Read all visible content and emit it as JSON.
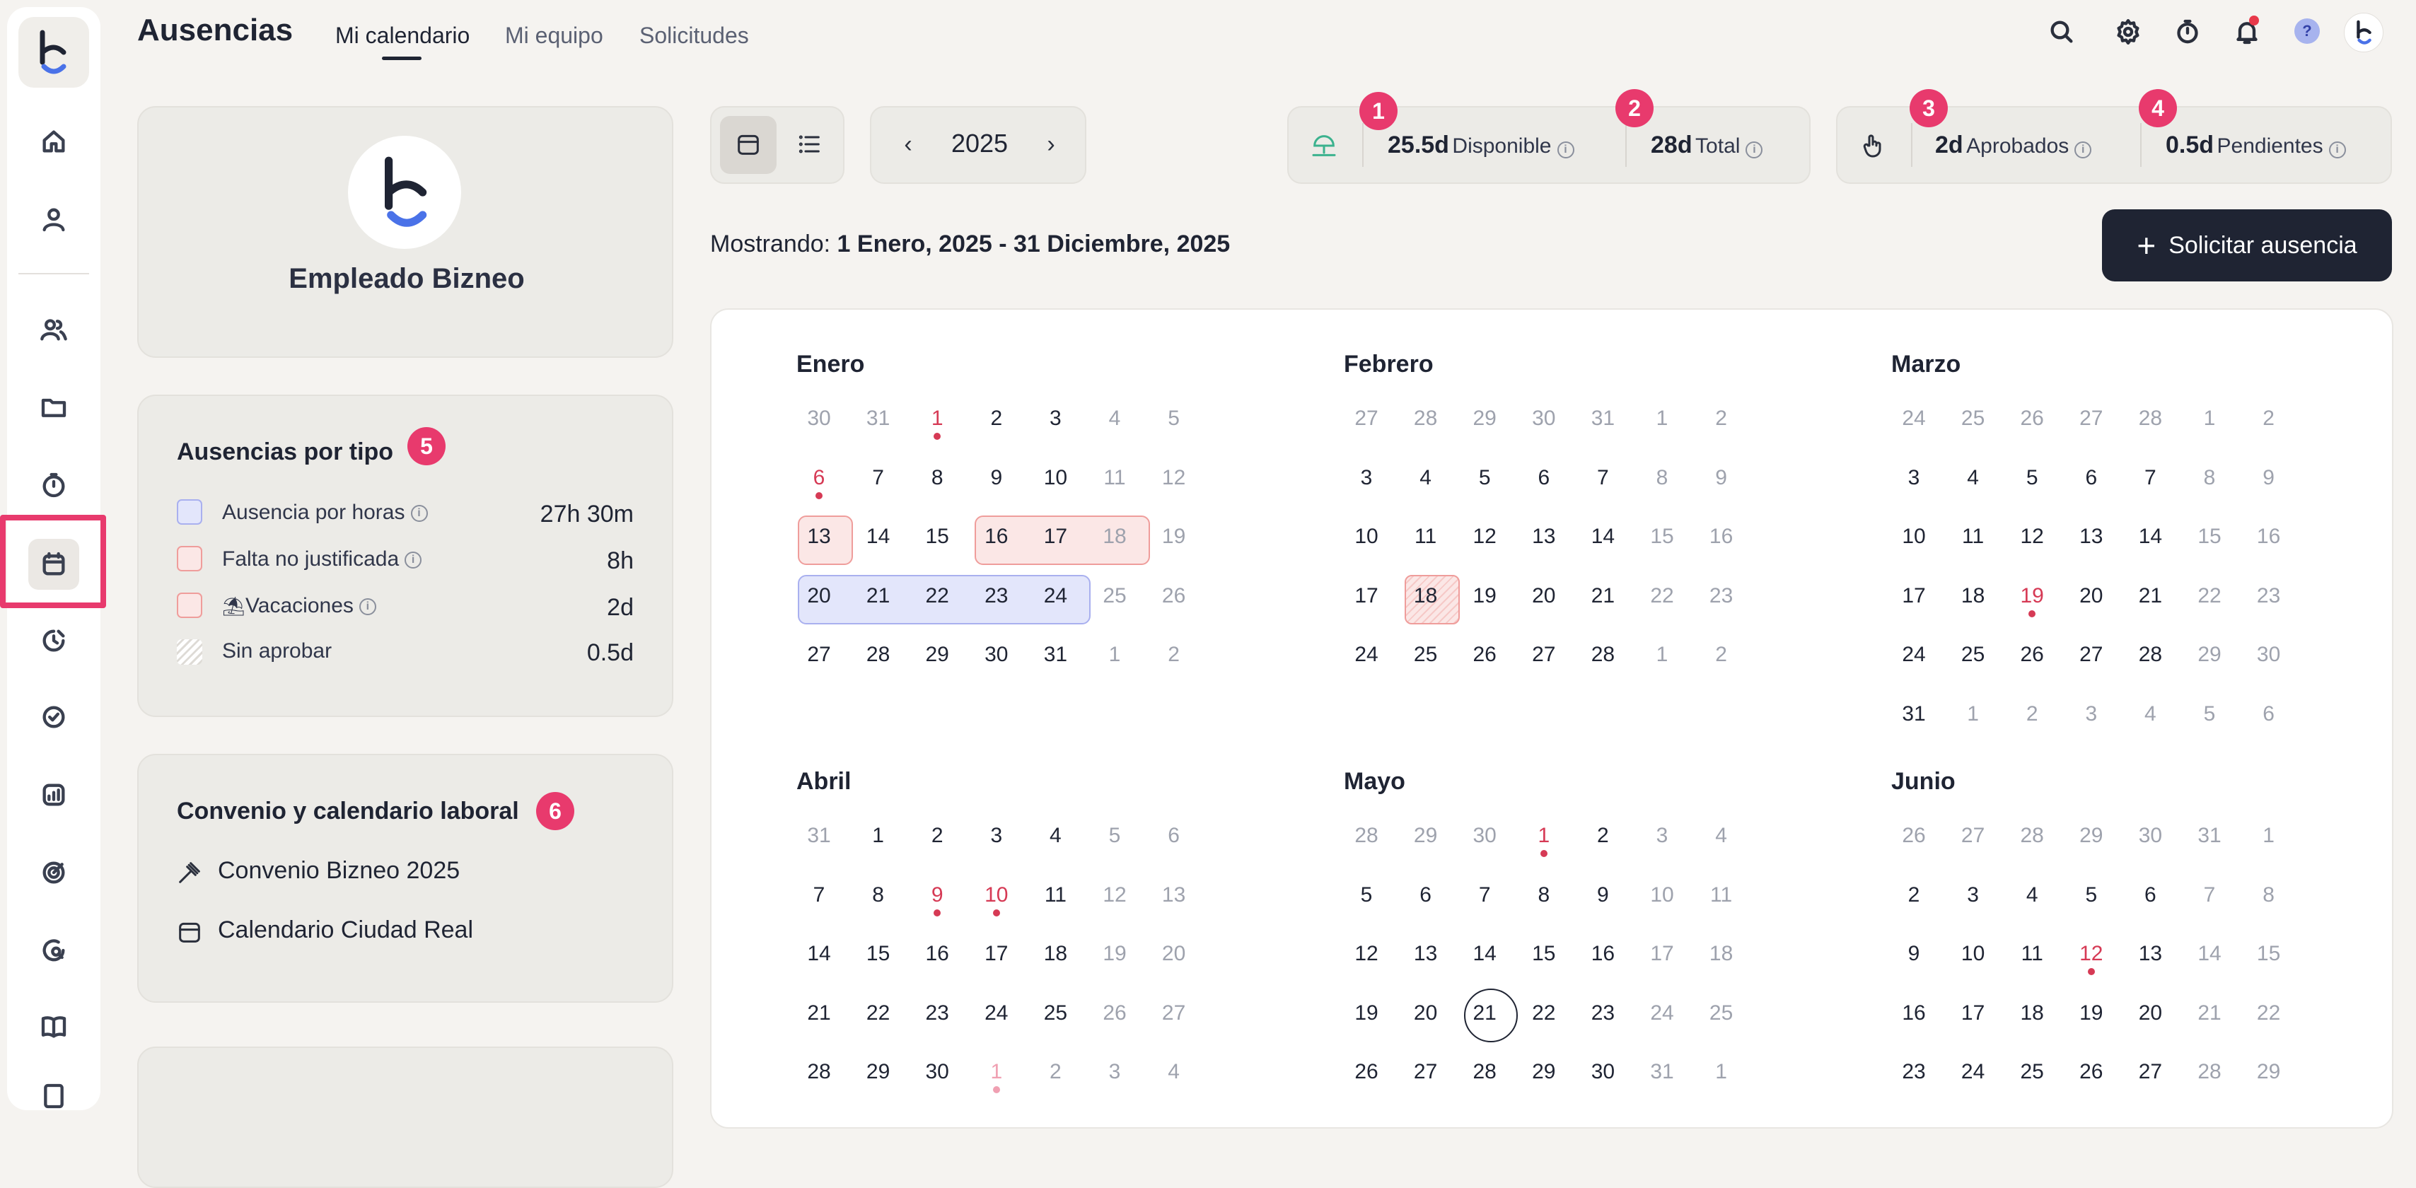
{
  "header": {
    "title": "Ausencias",
    "tabs": [
      "Mi calendario",
      "Mi equipo",
      "Solicitudes"
    ]
  },
  "sidebar": {
    "icons": [
      "home-icon",
      "user-icon",
      "team-icon",
      "folder-icon",
      "stopwatch-icon",
      "calendar-icon",
      "clock-chart-icon",
      "check-circle-icon",
      "analytics-icon",
      "target-icon",
      "chat-search-icon",
      "book-icon"
    ]
  },
  "profile": {
    "name": "Empleado Bizneo"
  },
  "absence_types": {
    "title": "Ausencias por tipo",
    "badge": "5",
    "items": [
      {
        "label": "Ausencia por horas",
        "value": "27h 30m"
      },
      {
        "label": "Falta no justificada",
        "value": "8h"
      },
      {
        "label": "Vacaciones",
        "value": "2d"
      },
      {
        "label": "Sin aprobar",
        "value": "0.5d"
      }
    ]
  },
  "convenio": {
    "title": "Convenio y calendario laboral",
    "badge": "6",
    "items": [
      "Convenio Bizneo 2025",
      "Calendario Ciudad Real"
    ]
  },
  "toolbar": {
    "year": "2025",
    "stats_a": [
      {
        "badge": "1",
        "value": "25.5d",
        "label": "Disponible"
      },
      {
        "badge": "2",
        "value": "28d",
        "label": "Total"
      }
    ],
    "stats_b": [
      {
        "badge": "3",
        "value": "2d",
        "label": "Aprobados"
      },
      {
        "badge": "4",
        "value": "0.5d",
        "label": "Pendientes"
      }
    ],
    "showing_prefix": "Mostrando:",
    "showing_range": "1 Enero, 2025 - 31 Diciembre, 2025",
    "request_button": "Solicitar ausencia"
  },
  "calendar": {
    "months": [
      {
        "name": "Enero",
        "weeks": [
          [
            "30",
            "31",
            "1",
            "2",
            "3",
            "4",
            "5"
          ],
          [
            "6",
            "7",
            "8",
            "9",
            "10",
            "11",
            "12"
          ],
          [
            "13",
            "14",
            "15",
            "16",
            "17",
            "18",
            "19"
          ],
          [
            "20",
            "21",
            "22",
            "23",
            "24",
            "25",
            "26"
          ],
          [
            "27",
            "28",
            "29",
            "30",
            "31",
            "1",
            "2"
          ]
        ]
      },
      {
        "name": "Febrero",
        "weeks": [
          [
            "27",
            "28",
            "29",
            "30",
            "31",
            "1",
            "2"
          ],
          [
            "3",
            "4",
            "5",
            "6",
            "7",
            "8",
            "9"
          ],
          [
            "10",
            "11",
            "12",
            "13",
            "14",
            "15",
            "16"
          ],
          [
            "17",
            "18",
            "19",
            "20",
            "21",
            "22",
            "23"
          ],
          [
            "24",
            "25",
            "26",
            "27",
            "28",
            "1",
            "2"
          ]
        ]
      },
      {
        "name": "Marzo",
        "weeks": [
          [
            "24",
            "25",
            "26",
            "27",
            "28",
            "1",
            "2"
          ],
          [
            "3",
            "4",
            "5",
            "6",
            "7",
            "8",
            "9"
          ],
          [
            "10",
            "11",
            "12",
            "13",
            "14",
            "15",
            "16"
          ],
          [
            "17",
            "18",
            "19",
            "20",
            "21",
            "22",
            "23"
          ],
          [
            "24",
            "25",
            "26",
            "27",
            "28",
            "29",
            "30"
          ],
          [
            "31",
            "1",
            "2",
            "3",
            "4",
            "5",
            "6"
          ]
        ]
      },
      {
        "name": "Abril",
        "weeks": [
          [
            "31",
            "1",
            "2",
            "3",
            "4",
            "5",
            "6"
          ],
          [
            "7",
            "8",
            "9",
            "10",
            "11",
            "12",
            "13"
          ],
          [
            "14",
            "15",
            "16",
            "17",
            "18",
            "19",
            "20"
          ],
          [
            "21",
            "22",
            "23",
            "24",
            "25",
            "26",
            "27"
          ],
          [
            "28",
            "29",
            "30",
            "1",
            "2",
            "3",
            "4"
          ]
        ]
      },
      {
        "name": "Mayo",
        "weeks": [
          [
            "28",
            "29",
            "30",
            "1",
            "2",
            "3",
            "4"
          ],
          [
            "5",
            "6",
            "7",
            "8",
            "9",
            "10",
            "11"
          ],
          [
            "12",
            "13",
            "14",
            "15",
            "16",
            "17",
            "18"
          ],
          [
            "19",
            "20",
            "21",
            "22",
            "23",
            "24",
            "25"
          ],
          [
            "26",
            "27",
            "28",
            "29",
            "30",
            "31",
            "1"
          ]
        ]
      },
      {
        "name": "Junio",
        "weeks": [
          [
            "26",
            "27",
            "28",
            "29",
            "30",
            "31",
            "1"
          ],
          [
            "2",
            "3",
            "4",
            "5",
            "6",
            "7",
            "8"
          ],
          [
            "9",
            "10",
            "11",
            "12",
            "13",
            "14",
            "15"
          ],
          [
            "16",
            "17",
            "18",
            "19",
            "20",
            "21",
            "22"
          ],
          [
            "23",
            "24",
            "25",
            "26",
            "27",
            "28",
            "29"
          ]
        ]
      }
    ]
  },
  "colors": {
    "accent": "#e83a6d",
    "dark": "#1f2433",
    "holiday": "#d63a55",
    "range_red_bg": "#fbe7e6",
    "range_blue_bg": "#e3e6fb"
  }
}
